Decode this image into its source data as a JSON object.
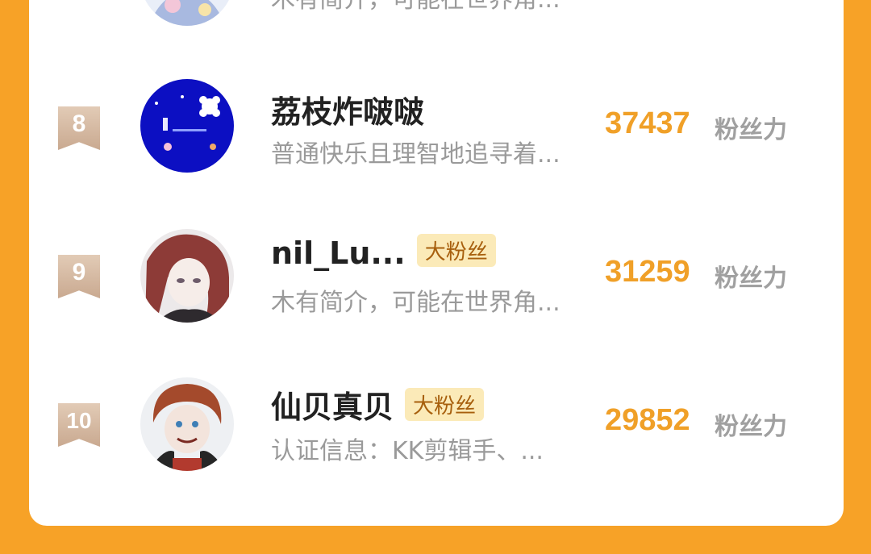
{
  "rows": [
    {
      "rank": "",
      "name": "",
      "bio": "木有简介，可能在世界角...",
      "score": "",
      "unit": ""
    },
    {
      "rank": "8",
      "name": "荔枝炸啵啵",
      "bio": "普通快乐且理智地追寻着...",
      "score": "37437",
      "unit": "粉丝力"
    },
    {
      "rank": "9",
      "name": "nil_Lu...",
      "badge": "大粉丝",
      "bio": "木有简介，可能在世界角...",
      "score": "31259",
      "unit": "粉丝力"
    },
    {
      "rank": "10",
      "name": "仙贝真贝",
      "badge": "大粉丝",
      "bio": "认证信息：KK剪辑手、...",
      "score": "29852",
      "unit": "粉丝力"
    }
  ],
  "colors": {
    "background": "#f7a227",
    "score": "#f0a028",
    "badge_bg": "#fbeab8",
    "rank_ribbon": "#c9a990"
  }
}
